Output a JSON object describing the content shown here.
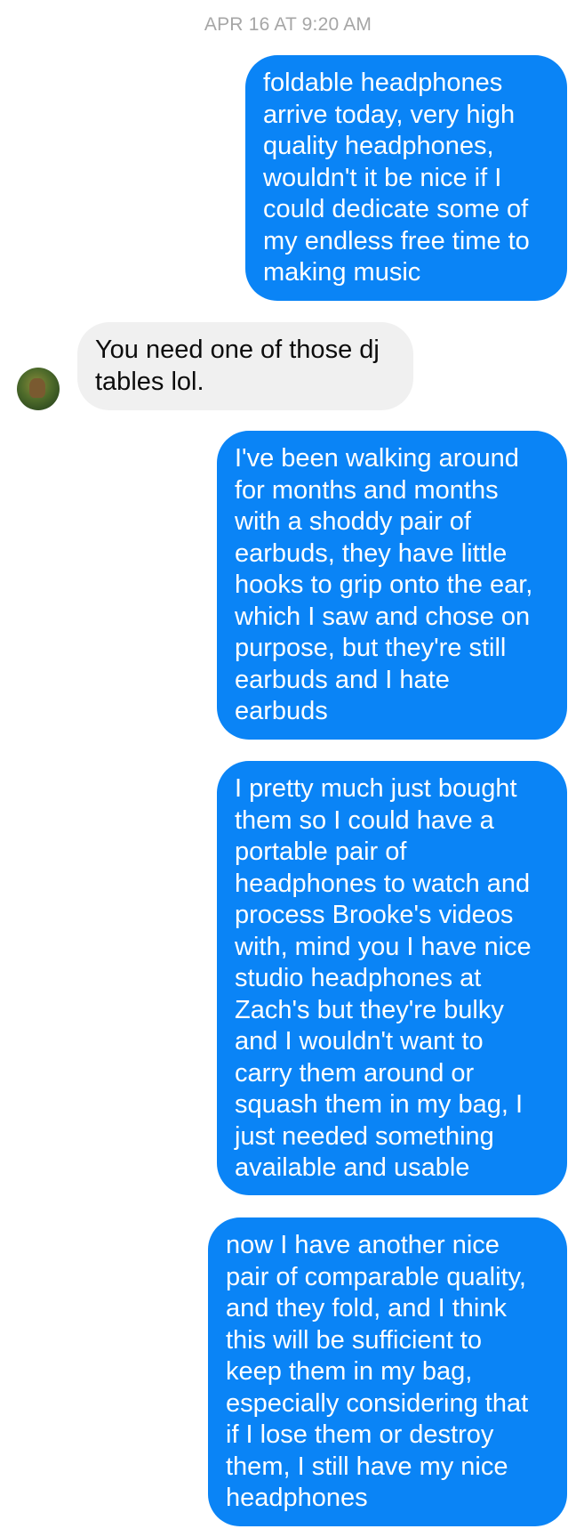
{
  "conversation": {
    "timestamp": "APR 16 AT 9:20 AM",
    "messages": [
      {
        "sender": "me",
        "text": "foldable headphones\narrive today, very high\nquality headphones,\nwouldn't it be nice if I\ncould dedicate some of\nmy endless free time to\nmaking music"
      },
      {
        "sender": "contact",
        "text": "You need one of those dj\ntables lol."
      },
      {
        "sender": "me",
        "text": "I've been walking around\nfor months and months\nwith a shoddy pair of\nearbuds, they have little\nhooks to grip onto the ear,\nwhich I saw and chose on\npurpose, but they're still\nearbuds and I hate\nearbuds"
      },
      {
        "sender": "me",
        "text": "I pretty much just bought\nthem so I could have a\nportable pair of\nheadphones to watch and\nprocess Brooke's videos\nwith, mind you I have nice\nstudio headphones at\nZach's but they're bulky\nand I wouldn't want to\ncarry them around or\nsquash them in my bag, I\njust needed something\navailable and usable"
      },
      {
        "sender": "me",
        "text": "now I have another nice\npair of comparable quality,\nand they fold, and I think\nthis will be sufficient to\nkeep them in my bag,\nespecially considering that\nif I lose them or destroy\nthem, I still have my nice\nheadphones"
      }
    ]
  },
  "colors": {
    "outgoing_bubble": "#0a84f6",
    "incoming_bubble": "#f0f0f0",
    "timestamp_text": "#a6a6a6"
  },
  "icons": {
    "avatar": "contact-avatar-photo"
  }
}
